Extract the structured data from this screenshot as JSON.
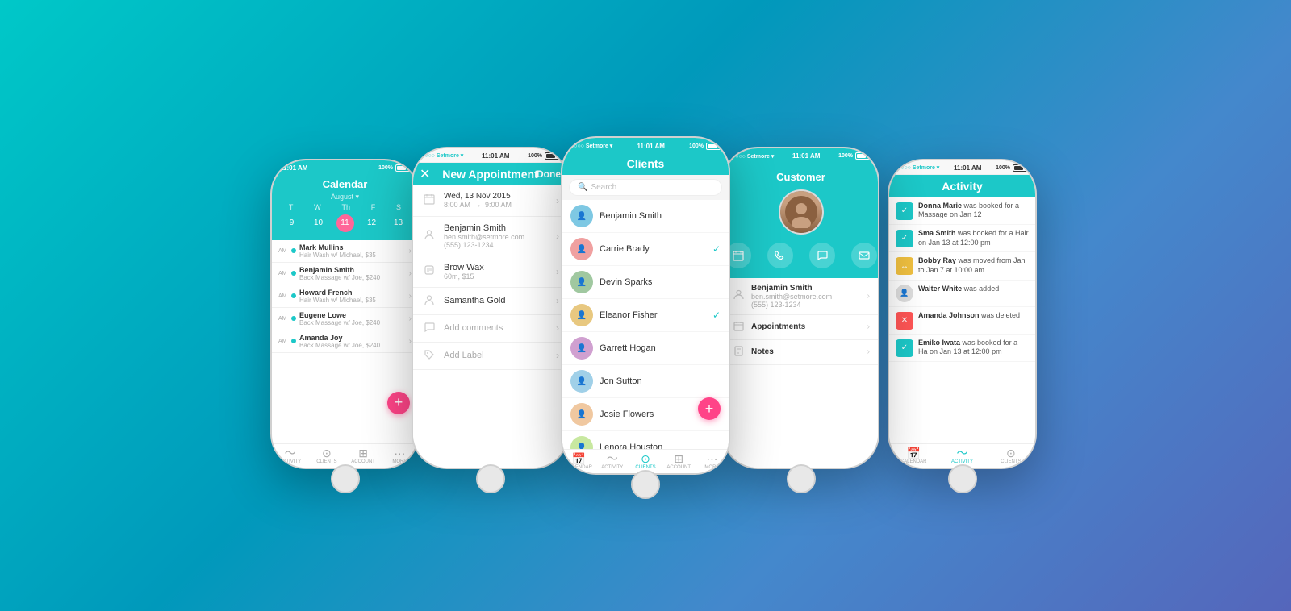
{
  "background": {
    "gradient_start": "#00c8c8",
    "gradient_end": "#5566bb"
  },
  "phone1": {
    "type": "calendar",
    "status_bar": {
      "time": "11:01 AM",
      "battery": "100%"
    },
    "header_title": "Calendar",
    "month": "August",
    "days_of_week": [
      "T",
      "W",
      "Th",
      "F",
      "S"
    ],
    "dates": [
      "9",
      "10",
      "11",
      "12",
      "13"
    ],
    "today_date": "11",
    "appointments": [
      {
        "time_label": "AM",
        "name": "Mark Mullins",
        "detail": "Hair Wash w/ Michael, $35"
      },
      {
        "time_label": "AM",
        "name": "Benjamin Smith",
        "detail": "Back Massage w/ Joe, $240"
      },
      {
        "time_label": "AM",
        "name": "Howard French",
        "detail": "Hair Wash w/ Michael, $35"
      },
      {
        "time_label": "AM",
        "name": "Eugene Lowe",
        "detail": "Back Massage w/ Joe, $240"
      },
      {
        "time_label": "AM",
        "name": "Amanda Joy",
        "detail": "Back Massage w/ Joe, $240"
      }
    ],
    "tabs": [
      {
        "label": "ACTIVITY",
        "icon": "📈"
      },
      {
        "label": "CLIENTS",
        "icon": "👤"
      },
      {
        "label": "ACCOUNT",
        "icon": "🏠"
      },
      {
        "label": "MORE",
        "icon": "⋯"
      }
    ]
  },
  "phone2": {
    "type": "new_appointment",
    "status_bar": {
      "signal": "○○○○",
      "carrier": "Setmore",
      "time": "11:01 AM",
      "battery": "100%"
    },
    "header_title": "New Appointment",
    "done_label": "Done",
    "form_items": [
      {
        "icon": "📅",
        "type": "date",
        "date": "Wed, 13 Nov 2015",
        "time_start": "8:00 AM",
        "arrow": "→",
        "time_end": "9:00 AM"
      },
      {
        "icon": "👤",
        "type": "client",
        "name": "Benjamin Smith",
        "email": "ben.smith@setmore.com",
        "phone": "(555) 123-1234"
      },
      {
        "icon": "💬",
        "type": "service",
        "name": "Brow Wax",
        "detail": "60m, $15"
      },
      {
        "icon": "👤",
        "type": "staff",
        "name": "Samantha Gold"
      },
      {
        "icon": "💬",
        "type": "comments",
        "name": "Add comments"
      },
      {
        "icon": "🏷",
        "type": "label",
        "name": "Add Label"
      }
    ]
  },
  "phone3": {
    "type": "clients",
    "status_bar": {
      "signal": "○○○○",
      "carrier": "Setmore",
      "time": "11:01 AM",
      "battery": "100%"
    },
    "header_title": "Clients",
    "search_placeholder": "Search",
    "clients": [
      {
        "name": "Benjamin Smith",
        "selected": false
      },
      {
        "name": "Carrie Brady",
        "selected": true
      },
      {
        "name": "Devin Sparks",
        "selected": false
      },
      {
        "name": "Eleanor Fisher",
        "selected": true
      },
      {
        "name": "Garrett Hogan",
        "selected": false
      },
      {
        "name": "Jon Sutton",
        "selected": false
      },
      {
        "name": "Josie Flowers",
        "selected": false
      },
      {
        "name": "Lenora Houston",
        "selected": false
      }
    ],
    "tabs": [
      {
        "label": "CALENDAR",
        "icon": "📅",
        "active": false
      },
      {
        "label": "ACTIVITY",
        "icon": "📈",
        "active": false
      },
      {
        "label": "CLIENTS",
        "icon": "👤",
        "active": true
      },
      {
        "label": "ACCOUNT",
        "icon": "🏠",
        "active": false
      },
      {
        "label": "MORE",
        "icon": "⋯",
        "active": false
      }
    ]
  },
  "phone4": {
    "type": "customer",
    "status_bar": {
      "signal": "○○○○",
      "carrier": "Setmore",
      "time": "11:01 AM",
      "battery": "100%"
    },
    "header_title": "Customer",
    "customer": {
      "name": "Benjamin Smith",
      "email": "ben.smith@setmore.com",
      "phone": "(555) 123-1234"
    },
    "action_buttons": [
      "📅",
      "📞",
      "💬",
      "✉"
    ],
    "sections": [
      {
        "label": "Appointments"
      },
      {
        "label": "Notes"
      }
    ]
  },
  "phone5": {
    "type": "activity",
    "status_bar": {
      "signal": "○○○○",
      "carrier": "Setmore",
      "time": "11:01 AM",
      "battery": "100%"
    },
    "header_title": "Activity",
    "activities": [
      {
        "type": "booked",
        "text_bold": "Donna Marie",
        "text": " was booked for a Massage on Jan 12",
        "badge": "check"
      },
      {
        "type": "booked",
        "text_bold": "Sma Smith",
        "text": " was booked for a Hair on Jan 13 at 12:00 pm",
        "badge": "check"
      },
      {
        "type": "moved",
        "text_bold": "Bobby Ray",
        "text": " was moved from Jan to Jan 7 at 10:00 am",
        "badge": "arrow"
      },
      {
        "type": "added",
        "text_bold": "Walter White",
        "text": " was added",
        "badge": "avatar"
      },
      {
        "type": "deleted",
        "text_bold": "Amanda Johnson",
        "text": " was deleted",
        "badge": "delete"
      },
      {
        "type": "booked",
        "text_bold": "Emiko Iwata",
        "text": " was booked for a Ha on Jan 13 at 12:00 pm",
        "badge": "check"
      }
    ],
    "tabs": [
      {
        "label": "CALENDAR",
        "icon": "📅",
        "active": false
      },
      {
        "label": "ACTIVITY",
        "icon": "📈",
        "active": true
      },
      {
        "label": "CLIENTS",
        "icon": "👤",
        "active": false
      }
    ]
  }
}
